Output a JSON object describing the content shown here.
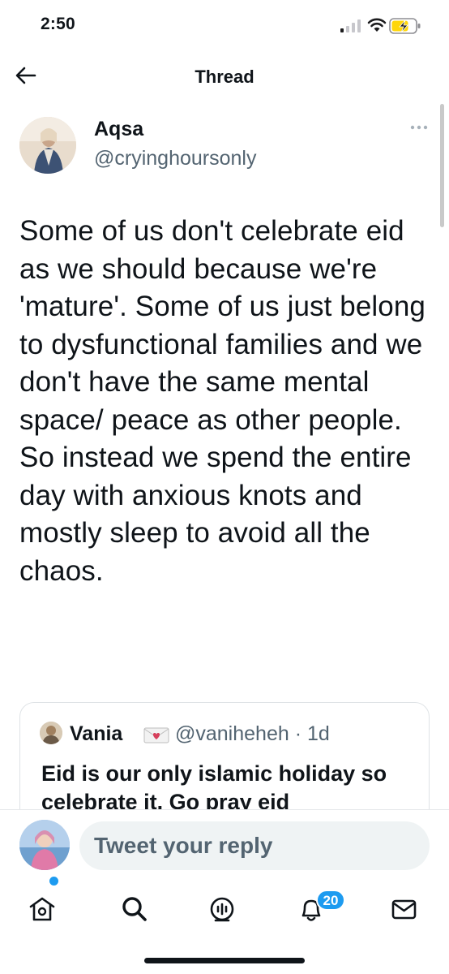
{
  "status_bar": {
    "time": "2:50"
  },
  "header": {
    "title": "Thread"
  },
  "tweet": {
    "author_name": "Aqsa",
    "author_handle": "@cryinghoursonly",
    "text": "Some of us don't celebrate eid as we should because we're 'mature'. Some of us just belong to dysfunctional families and we don't have the same mental space/ peace as other people. So instead we spend the entire day with anxious knots and mostly sleep to avoid all the chaos."
  },
  "quote": {
    "author_name": "Vania",
    "author_handle": "@vaniheheh · 1d",
    "text": "Eid is our only islamic holiday so celebrate it. Go pray eid"
  },
  "reply": {
    "placeholder": "Tweet your reply"
  },
  "nav": {
    "items": [
      {
        "name": "home"
      },
      {
        "name": "search"
      },
      {
        "name": "spaces"
      },
      {
        "name": "notifications",
        "badge": "20"
      },
      {
        "name": "messages"
      }
    ]
  },
  "colors": {
    "accent": "#1d9bf0",
    "text": "#0f1419",
    "muted": "#536471"
  }
}
